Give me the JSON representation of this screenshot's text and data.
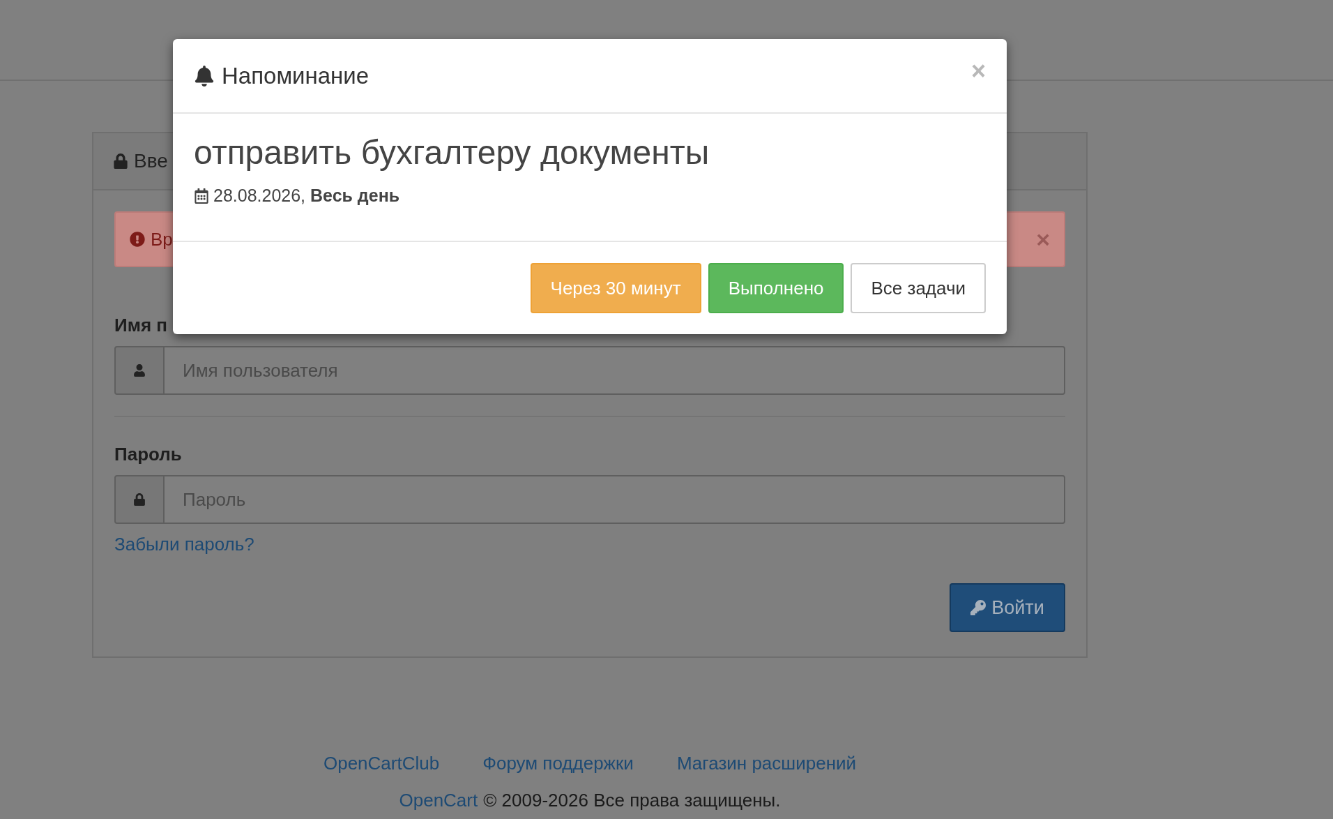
{
  "login_panel": {
    "heading": "Вве",
    "alert": {
      "message": "Вр",
      "close": "×"
    },
    "username": {
      "label": "Имя п",
      "placeholder": "Имя пользователя"
    },
    "password": {
      "label": "Пароль",
      "placeholder": "Пароль"
    },
    "forgot_link": "Забыли пароль?",
    "login_button": "Войти"
  },
  "footer": {
    "links": [
      "OpenCartClub",
      "Форум поддержки",
      "Магазин расширений"
    ],
    "copyright_link": "OpenCart",
    "copyright": "© 2009-2026 Все права защищены."
  },
  "modal": {
    "title": "Напоминание",
    "close": "×",
    "task": "отправить бухгалтеру документы",
    "date": "28.08.2026, **Весь день**",
    "buttons": [
      {
        "label": "Через 30 минут",
        "kind": "warning"
      },
      {
        "label": "Выполнено",
        "kind": "success"
      },
      {
        "label": "Все задачи",
        "kind": "default"
      }
    ]
  }
}
